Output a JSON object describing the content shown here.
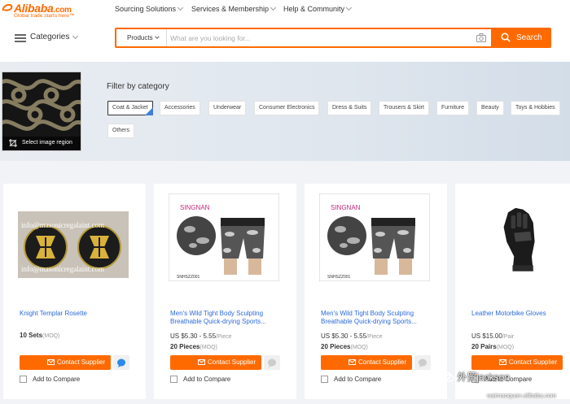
{
  "header": {
    "logo_text": "Alibaba",
    "logo_suffix": ".com",
    "logo_tagline": "Global trade starts here™",
    "nav": [
      "Sourcing Solutions",
      "Services & Membership",
      "Help & Community"
    ],
    "categories_label": "Categories"
  },
  "search": {
    "scope": "Products",
    "placeholder": "What are you looking for...",
    "button_label": "Search",
    "accent": "#ff6a00"
  },
  "filter": {
    "image_caption": "Select image region",
    "title": "Filter by category",
    "chips": [
      "Coat & Jacket",
      "Accessories",
      "Underwear",
      "Consumer Electronics",
      "Dress & Suits",
      "Trousers & Skirt",
      "Furniture",
      "Beauty",
      "Toys & Hobbies",
      "Others"
    ],
    "active_chip": "Coat & Jacket"
  },
  "products": [
    {
      "title": "Knight Templar Rosette",
      "price": "",
      "unit": "",
      "moq_qty": "10 Sets",
      "moq_label": "(MOQ)",
      "contact_label": "Contact Supplier",
      "compare_label": "Add to Compare",
      "image_text": "info@masonicregalaint.com"
    },
    {
      "title": "Men's Wild Tight Body Sculpting Breathable Quick-drying Sports...",
      "price": "US $5.30 - 5.55",
      "unit": "/Piece",
      "moq_qty": "20 Pieces",
      "moq_label": "(MOQ)",
      "contact_label": "Contact Supplier",
      "compare_label": "Add to Compare",
      "image_code": "SNHSZZ001"
    },
    {
      "title": "Men's Wild Tight Body Sculpting Breathable Quick-drying Sports...",
      "price": "US $5.30 - 5.55",
      "unit": "/Piece",
      "moq_qty": "20 Pieces",
      "moq_label": "(MOQ)",
      "contact_label": "Contact Supplier",
      "compare_label": "Add to Compare",
      "image_code": "SNHSZZ001"
    },
    {
      "title": "Leather Motorbike Gloves",
      "price": "US $15.00",
      "unit": "/Pair",
      "moq_qty": "20 Pairs",
      "moq_label": "(MOQ)",
      "contact_label": "Contact Supplier",
      "compare_label": "Add to Compare"
    }
  ],
  "watermark": {
    "line1": "外贸jackson",
    "line2": "waimaoquan.alibaba.com"
  }
}
